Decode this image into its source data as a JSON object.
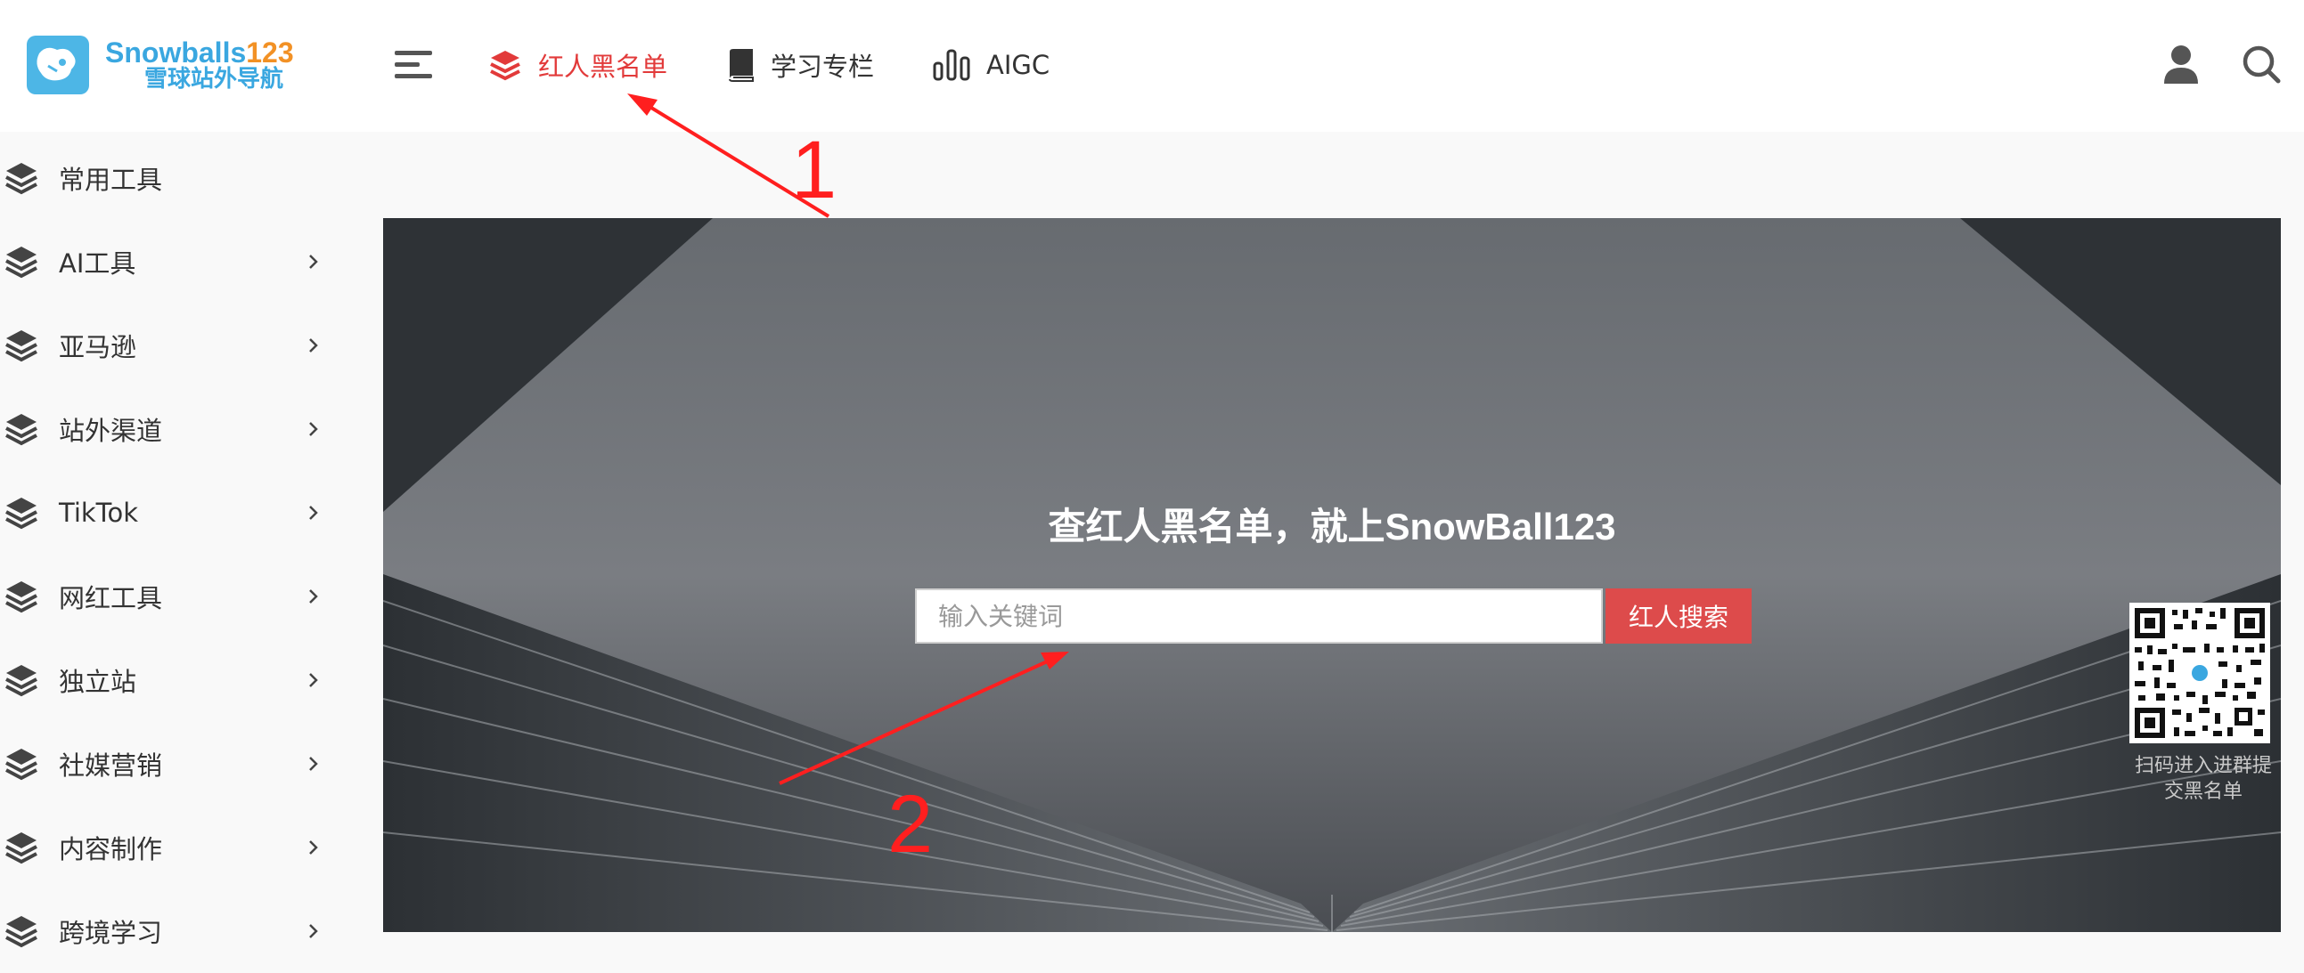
{
  "header": {
    "logo_line1": "Snowballs",
    "logo_line1_num": "123",
    "logo_line2": "雪球站外导航",
    "nav": [
      {
        "label": "红人黑名单",
        "icon": "layers-icon",
        "active": true
      },
      {
        "label": "学习专栏",
        "icon": "book-icon",
        "active": false
      },
      {
        "label": "AIGC",
        "icon": "bar-chart-icon",
        "active": false
      }
    ]
  },
  "sidebar": {
    "items": [
      {
        "label": "常用工具",
        "has_arrow": false
      },
      {
        "label": "AI工具",
        "has_arrow": true
      },
      {
        "label": "亚马逊",
        "has_arrow": true
      },
      {
        "label": "站外渠道",
        "has_arrow": true
      },
      {
        "label": "TikTok",
        "has_arrow": true
      },
      {
        "label": "网红工具",
        "has_arrow": true
      },
      {
        "label": "独立站",
        "has_arrow": true
      },
      {
        "label": "社媒营销",
        "has_arrow": true
      },
      {
        "label": "内容制作",
        "has_arrow": true
      },
      {
        "label": "跨境学习",
        "has_arrow": true
      }
    ]
  },
  "hero": {
    "title": "查红人黑名单，就上SnowBall123",
    "search_placeholder": "输入关键词",
    "search_button": "红人搜索",
    "qr_caption": "扫码进入进群提交黑名单"
  },
  "annotations": {
    "label_1": "1",
    "label_2": "2"
  },
  "colors": {
    "accent_red": "#e23a3a",
    "button_red": "#dd4b4b",
    "logo_blue": "#3aa7e0",
    "logo_orange": "#f29125"
  }
}
